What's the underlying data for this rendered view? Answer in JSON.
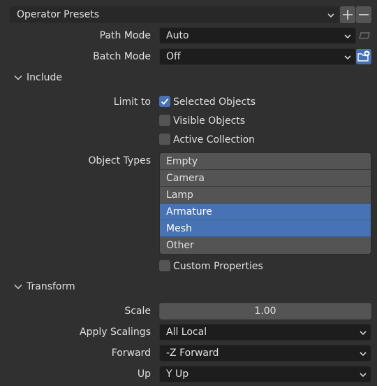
{
  "presets": {
    "label": "Operator Presets",
    "add_icon": "plus-icon",
    "remove_icon": "minus-icon"
  },
  "path_mode": {
    "label": "Path Mode",
    "value": "Auto",
    "side_icon": "embed-icon"
  },
  "batch_mode": {
    "label": "Batch Mode",
    "value": "Off",
    "side_icon": "new-folder-icon"
  },
  "include": {
    "header": "Include",
    "limit_to_label": "Limit to",
    "checkboxes": [
      {
        "label": "Selected Objects",
        "checked": true
      },
      {
        "label": "Visible Objects",
        "checked": false
      },
      {
        "label": "Active Collection",
        "checked": false
      }
    ],
    "object_types_label": "Object Types",
    "object_types": [
      {
        "label": "Empty",
        "selected": false
      },
      {
        "label": "Camera",
        "selected": false
      },
      {
        "label": "Lamp",
        "selected": false
      },
      {
        "label": "Armature",
        "selected": true
      },
      {
        "label": "Mesh",
        "selected": true
      },
      {
        "label": "Other",
        "selected": false
      }
    ],
    "custom_properties": {
      "label": "Custom Properties",
      "checked": false
    }
  },
  "transform": {
    "header": "Transform",
    "scale": {
      "label": "Scale",
      "value": "1.00"
    },
    "apply_scalings": {
      "label": "Apply Scalings",
      "value": "All Local"
    },
    "forward": {
      "label": "Forward",
      "value": "-Z Forward"
    },
    "up": {
      "label": "Up",
      "value": "Y Up"
    }
  },
  "colors": {
    "accent": "#4772b3",
    "background": "#303030",
    "field": "#1d1d1d",
    "item": "#545454"
  }
}
